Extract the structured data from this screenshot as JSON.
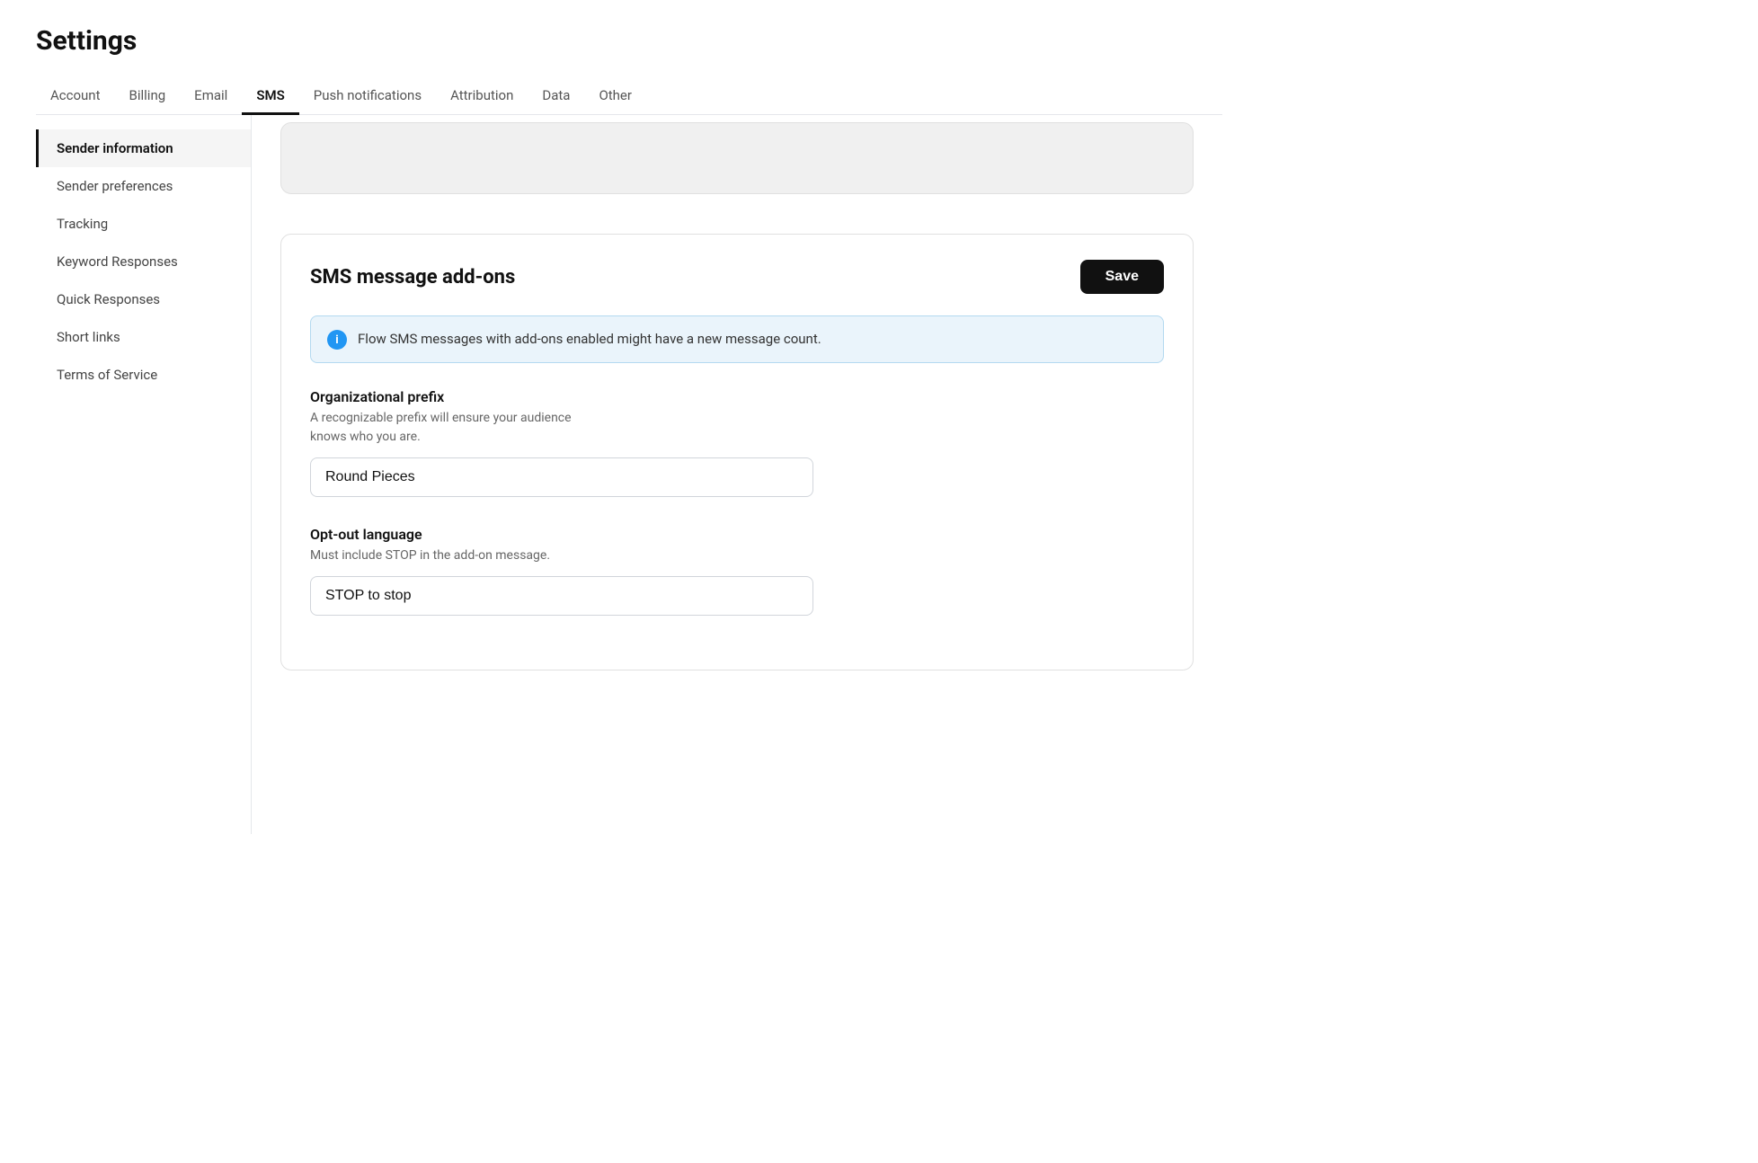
{
  "page": {
    "title": "Settings"
  },
  "top_nav": {
    "items": [
      {
        "id": "account",
        "label": "Account",
        "active": false
      },
      {
        "id": "billing",
        "label": "Billing",
        "active": false
      },
      {
        "id": "email",
        "label": "Email",
        "active": false
      },
      {
        "id": "sms",
        "label": "SMS",
        "active": true
      },
      {
        "id": "push-notifications",
        "label": "Push notifications",
        "active": false
      },
      {
        "id": "attribution",
        "label": "Attribution",
        "active": false
      },
      {
        "id": "data",
        "label": "Data",
        "active": false
      },
      {
        "id": "other",
        "label": "Other",
        "active": false
      }
    ]
  },
  "sidebar": {
    "items": [
      {
        "id": "sender-information",
        "label": "Sender information",
        "active": true
      },
      {
        "id": "sender-preferences",
        "label": "Sender preferences",
        "active": false
      },
      {
        "id": "tracking",
        "label": "Tracking",
        "active": false
      },
      {
        "id": "keyword-responses",
        "label": "Keyword Responses",
        "active": false
      },
      {
        "id": "quick-responses",
        "label": "Quick Responses",
        "active": false
      },
      {
        "id": "short-links",
        "label": "Short links",
        "active": false
      },
      {
        "id": "terms-of-service",
        "label": "Terms of Service",
        "active": false
      }
    ]
  },
  "card_addons": {
    "title": "SMS message add-ons",
    "save_label": "Save",
    "info_text": "Flow SMS messages with add-ons enabled might have a new message count.",
    "org_prefix": {
      "label": "Organizational prefix",
      "description_line1": "A recognizable prefix will ensure your audience",
      "description_line2": "knows who you are.",
      "value": "Round Pieces",
      "placeholder": "Round Pieces"
    },
    "opt_out": {
      "label": "Opt-out language",
      "description": "Must include STOP in the add-on message.",
      "value": "STOP to stop",
      "placeholder": "STOP to stop"
    }
  }
}
